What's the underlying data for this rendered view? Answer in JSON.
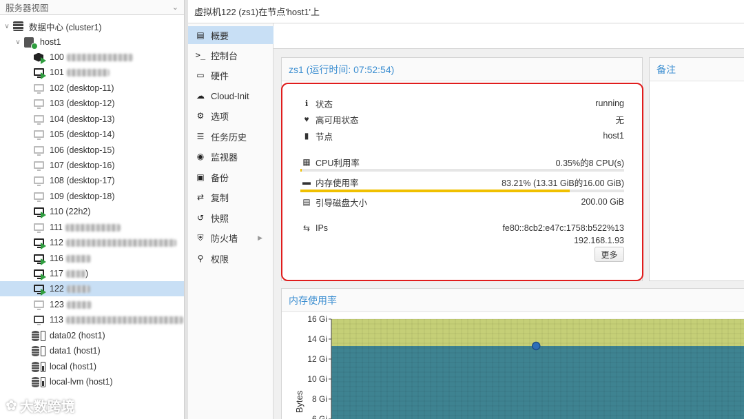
{
  "tree": {
    "header": "服务器视图",
    "items": [
      {
        "label": "数据中心 (cluster1)",
        "icon": "datacenter-icon"
      },
      {
        "label": "host1",
        "icon": "node-online-icon"
      },
      {
        "label": "100",
        "icon": "container-running-icon"
      },
      {
        "label": "101",
        "icon": "vm-running-icon"
      },
      {
        "label": "102 (desktop-11)",
        "icon": "vm-stopped-icon"
      },
      {
        "label": "103 (desktop-12)",
        "icon": "vm-stopped-icon"
      },
      {
        "label": "104 (desktop-13)",
        "icon": "vm-stopped-icon"
      },
      {
        "label": "105 (desktop-14)",
        "icon": "vm-stopped-icon"
      },
      {
        "label": "106 (desktop-15)",
        "icon": "vm-stopped-icon"
      },
      {
        "label": "107 (desktop-16)",
        "icon": "vm-stopped-icon"
      },
      {
        "label": "108 (desktop-17)",
        "icon": "vm-stopped-icon"
      },
      {
        "label": "109 (desktop-18)",
        "icon": "vm-stopped-icon"
      },
      {
        "label": "110 (22h2)",
        "icon": "vm-running-icon"
      },
      {
        "label": "111",
        "icon": "vm-stopped-icon"
      },
      {
        "label": "112",
        "icon": "vm-running-icon"
      },
      {
        "label": "116",
        "icon": "vm-running-icon"
      },
      {
        "label": "117",
        "icon": "vm-running-icon"
      },
      {
        "label": "122",
        "icon": "vm-running-icon"
      },
      {
        "label": "123",
        "icon": "vm-stopped-icon"
      },
      {
        "label": "113",
        "icon": "vm-template-icon"
      },
      {
        "label": "data02 (host1)",
        "icon": "storage-icon"
      },
      {
        "label": "data1 (host1)",
        "icon": "storage-icon"
      },
      {
        "label": "local (host1)",
        "icon": "storage-icon"
      },
      {
        "label": "local-lvm (host1)",
        "icon": "storage-icon"
      }
    ],
    "tail_117": ")"
  },
  "header": {
    "title": "虚拟机122 (zs1)在节点'host1'上"
  },
  "nav": {
    "items": [
      {
        "label": "概要",
        "icon": "book-icon"
      },
      {
        "label": "控制台",
        "icon": "terminal-icon"
      },
      {
        "label": "硬件",
        "icon": "desktop-icon"
      },
      {
        "label": "Cloud-Init",
        "icon": "cloud-icon"
      },
      {
        "label": "选项",
        "icon": "gear-icon"
      },
      {
        "label": "任务历史",
        "icon": "list-icon"
      },
      {
        "label": "监视器",
        "icon": "eye-icon"
      },
      {
        "label": "备份",
        "icon": "floppy-icon"
      },
      {
        "label": "复制",
        "icon": "retweet-icon"
      },
      {
        "label": "快照",
        "icon": "history-icon"
      },
      {
        "label": "防火墙",
        "icon": "shield-icon"
      },
      {
        "label": "权限",
        "icon": "unlock-icon"
      }
    ]
  },
  "status": {
    "title": "zs1 (运行时间: 07:52:54)",
    "state_label": "状态",
    "state_value": "running",
    "ha_label": "高可用状态",
    "ha_value": "无",
    "node_label": "节点",
    "node_value": "host1",
    "cpu_label": "CPU利用率",
    "cpu_value": "0.35%的8 CPU(s)",
    "cpu_fraction": 0.0035,
    "mem_label": "内存使用率",
    "mem_value": "83.21% (13.31 GiB的16.00 GiB)",
    "mem_fraction": 0.8321,
    "disk_label": "引导磁盘大小",
    "disk_value": "200.00 GiB",
    "ips_label": "IPs",
    "ip1": "fe80::8cb2:e47c:1758:b522%13",
    "ip2": "192.168.1.93",
    "more_button": "更多"
  },
  "notes": {
    "title": "备注"
  },
  "memory_chart": {
    "title": "内存使用率"
  },
  "chart_data": {
    "type": "area",
    "title": "内存使用率",
    "ylabel": "Bytes",
    "ylim": [
      6,
      16
    ],
    "y_ticks": [
      "16 Gi",
      "14 Gi",
      "12 Gi",
      "10 Gi",
      "8 Gi",
      "6 Gi"
    ],
    "series": [
      {
        "name": "",
        "values": [
          16,
          16,
          16,
          16,
          16,
          16,
          16,
          16,
          16,
          16,
          16,
          16
        ]
      },
      {
        "name": "",
        "values": [
          13.31,
          13.31,
          13.31,
          13.31,
          13.31,
          13.31,
          13.31,
          13.31,
          13.31,
          13.31,
          13.31,
          13.31
        ]
      }
    ],
    "colors": {
      "total": "#c5cf77",
      "used": "#3e8391",
      "point": "#2d6fb8"
    }
  },
  "watermark": {
    "text": "大数跨境"
  }
}
